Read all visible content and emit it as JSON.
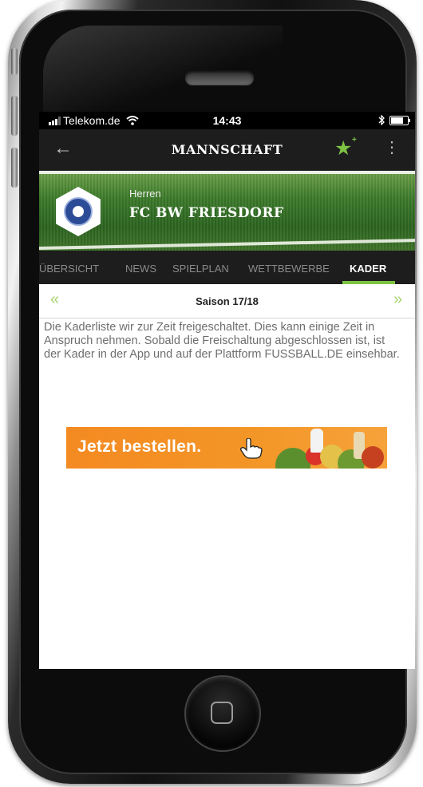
{
  "status_bar": {
    "carrier": "Telekom.de",
    "time": "14:43",
    "bluetooth": "bluetooth-icon",
    "battery_level": 0.85
  },
  "app_bar": {
    "title": "MANNSCHAFT",
    "back_icon": "arrow-left-icon",
    "favorite_icon": "star-add-icon",
    "more_icon": "more-vertical-icon",
    "accent_color": "#7dc243"
  },
  "team": {
    "category": "Herren",
    "name": "FC BW FRIESDORF"
  },
  "tabs": [
    {
      "label": "ÜBERSICHT",
      "active": false
    },
    {
      "label": "NEWS",
      "active": false
    },
    {
      "label": "SPIELPLAN",
      "active": false
    },
    {
      "label": "WETTBEWERBE",
      "active": false
    },
    {
      "label": "KADER",
      "active": true
    }
  ],
  "season": {
    "label": "Saison 17/18",
    "prev_icon": "double-chevron-left-icon",
    "next_icon": "double-chevron-right-icon"
  },
  "info_text": "Die Kaderliste wir zur Zeit freigeschaltet. Dies kann einige Zeit in Anspruch nehmen. Sobald die Freischaltung abgeschlossen ist, ist der Kader in der App und auf der Plattform FUSSBALL.DE einsehbar.",
  "ad_banner": {
    "text": "Jetzt bestellen.",
    "color": "#f48a22"
  }
}
